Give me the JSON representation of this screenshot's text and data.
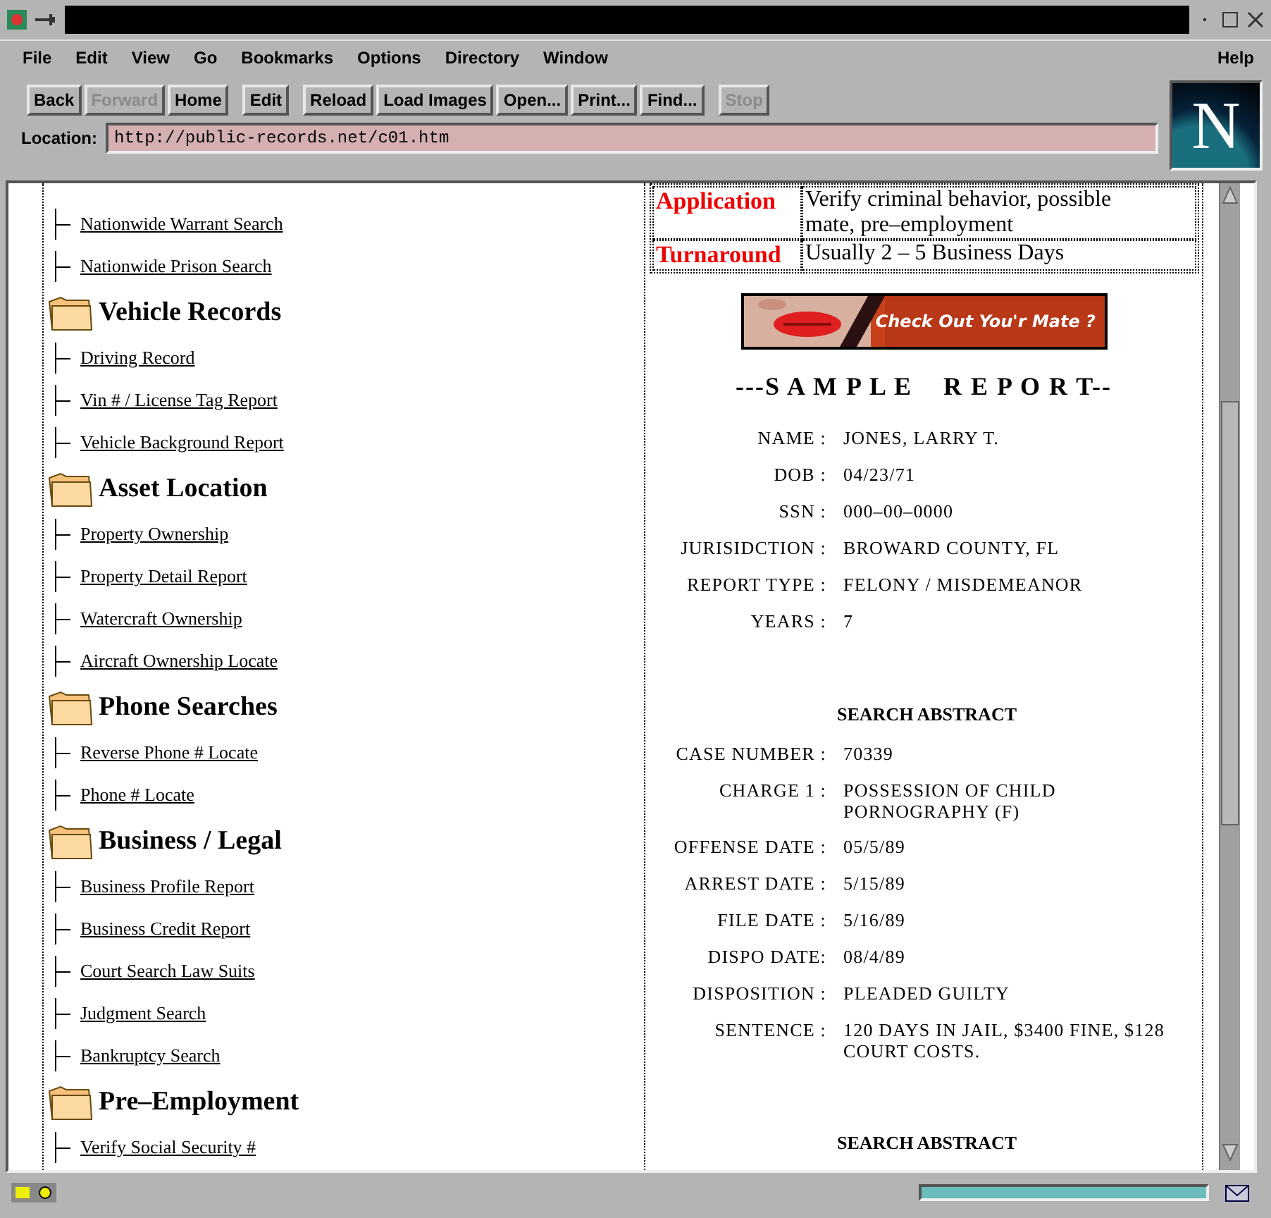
{
  "menu": [
    "File",
    "Edit",
    "View",
    "Go",
    "Bookmarks",
    "Options",
    "Directory",
    "Window"
  ],
  "help_menu": "Help",
  "toolbar": [
    {
      "label": "Back",
      "disabled": false
    },
    {
      "label": "Forward",
      "disabled": true
    },
    {
      "label": "Home",
      "disabled": false
    },
    {
      "label": "Edit",
      "disabled": false
    },
    {
      "label": "Reload",
      "disabled": false
    },
    {
      "label": "Load Images",
      "disabled": false
    },
    {
      "label": "Open...",
      "disabled": false
    },
    {
      "label": "Print...",
      "disabled": false
    },
    {
      "label": "Find...",
      "disabled": false
    },
    {
      "label": "Stop",
      "disabled": true
    }
  ],
  "location": {
    "label": "Location:",
    "value": "http://public-records.net/c01.htm"
  },
  "logo": "N",
  "nav": {
    "leading_items": [
      "Nationwide Warrant Search",
      "Nationwide Prison Search"
    ],
    "sections": [
      {
        "title": "Vehicle Records",
        "items": [
          "Driving Record",
          "Vin # / License Tag Report",
          "Vehicle Background Report"
        ]
      },
      {
        "title": "Asset Location",
        "items": [
          "Property Ownership",
          "Property Detail Report",
          "Watercraft Ownership",
          "Aircraft Ownership Locate"
        ]
      },
      {
        "title": "Phone Searches",
        "items": [
          "Reverse Phone # Locate",
          "Phone # Locate"
        ]
      },
      {
        "title": "Business / Legal",
        "items": [
          "Business Profile Report",
          "Business Credit Report",
          "Court Search Law Suits",
          "Judgment Search",
          "Bankruptcy Search"
        ]
      },
      {
        "title": "Pre–Employment",
        "items": [
          "Verify Social Security #"
        ]
      }
    ]
  },
  "info_table": [
    {
      "label": "Application",
      "value": "Verify criminal behavior, possible mate, pre–employment"
    },
    {
      "label": "Turnaround",
      "value": "Usually 2 – 5 Business Days"
    }
  ],
  "banner": {
    "kind": "picture",
    "text": "Check Out You'r Mate ?"
  },
  "report_title": "---S A M P L E    R E P O R T--",
  "report_fields": [
    {
      "label": "NAME :",
      "value": "JONES, LARRY T."
    },
    {
      "label": "DOB :",
      "value": "04/23/71"
    },
    {
      "label": "SSN :",
      "value": "000–00–0000"
    },
    {
      "label": "JURISIDCTION :",
      "value": "BROWARD COUNTY, FL"
    },
    {
      "label": "REPORT TYPE :",
      "value": "FELONY / MISDEMEANOR"
    },
    {
      "label": "YEARS :",
      "value": "7"
    }
  ],
  "abstracts": [
    {
      "title": "SEARCH ABSTRACT",
      "fields": [
        {
          "label": "CASE NUMBER :",
          "value": "70339"
        },
        {
          "label": "CHARGE 1 :",
          "value": "POSSESSION OF CHILD PORNOGRAPHY (F)"
        },
        {
          "label": "OFFENSE DATE :",
          "value": "05/5/89"
        },
        {
          "label": "ARREST DATE :",
          "value": "5/15/89"
        },
        {
          "label": "FILE DATE :",
          "value": "5/16/89"
        },
        {
          "label": "DISPO DATE:",
          "value": "08/4/89"
        },
        {
          "label": "DISPOSITION :",
          "value": "PLEADED GUILTY"
        },
        {
          "label": "SENTENCE :",
          "value": "120 DAYS IN JAIL, $3400 FINE, $128 COURT COSTS."
        }
      ]
    },
    {
      "title": "SEARCH ABSTRACT"
    }
  ],
  "status_bar": {
    "progress": {
      "level": 1
    }
  }
}
